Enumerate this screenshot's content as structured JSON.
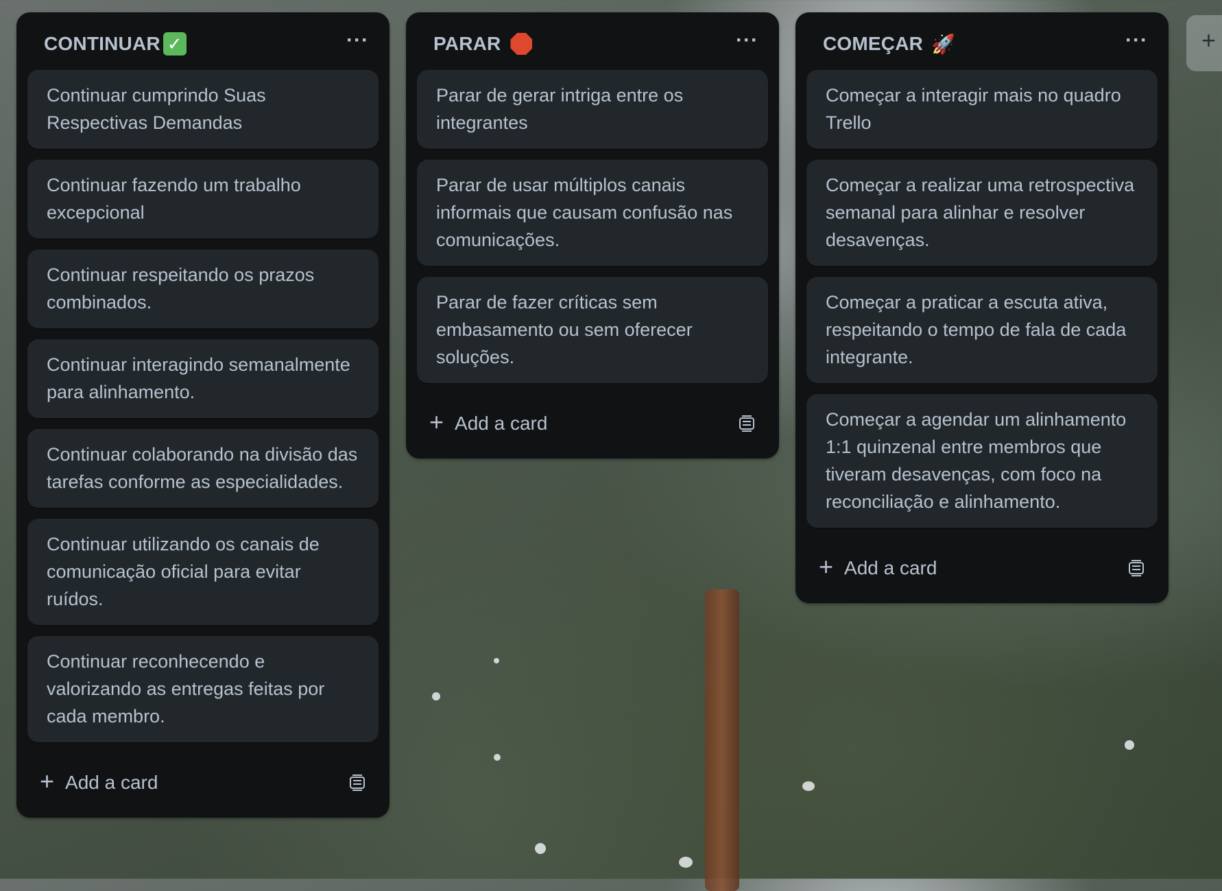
{
  "lists": [
    {
      "title": "CONTINUAR",
      "title_emoji": "✓",
      "title_emoji_name": "check-mark-button-emoji",
      "menu_label": "···",
      "cards": [
        "Continuar cumprindo Suas Respectivas Demandas",
        "Continuar fazendo um trabalho excepcional",
        "Continuar respeitando os prazos combinados.",
        "Continuar interagindo semanalmente para alinhamento.",
        "Continuar colaborando na divisão das tarefas conforme as especialidades.",
        "Continuar utilizando os canais de comunicação oficial para evitar ruídos.",
        "Continuar reconhecendo e valorizando as entregas feitas por cada membro."
      ],
      "add_card_label": "Add a card"
    },
    {
      "title": "PARAR",
      "title_emoji": "",
      "title_emoji_name": "stop-sign-emoji",
      "menu_label": "···",
      "cards": [
        "Parar de gerar intriga entre os integrantes",
        "Parar de usar múltiplos canais informais que causam confusão nas comunicações.",
        "Parar de fazer críticas sem embasamento ou sem oferecer soluções."
      ],
      "add_card_label": "Add a card"
    },
    {
      "title": "COMEÇAR",
      "title_emoji": "🚀",
      "title_emoji_name": "rocket-emoji",
      "menu_label": "···",
      "cards": [
        "Começar a interagir mais no quadro Trello",
        "Começar a realizar uma retrospectiva semanal para alinhar e resolver desavenças.",
        "Começar a praticar a escuta ativa, respeitando o tempo de fala de cada integrante.",
        "Começar a agendar um alinhamento 1:1 quinzenal entre membros que tiveram desavenças, com foco na reconciliação e alinhamento."
      ],
      "add_card_label": "Add a card"
    }
  ],
  "add_list_icon": "+",
  "colors": {
    "list_bg": "#111214",
    "card_bg": "#22272b",
    "text": "#b6c2cf"
  }
}
